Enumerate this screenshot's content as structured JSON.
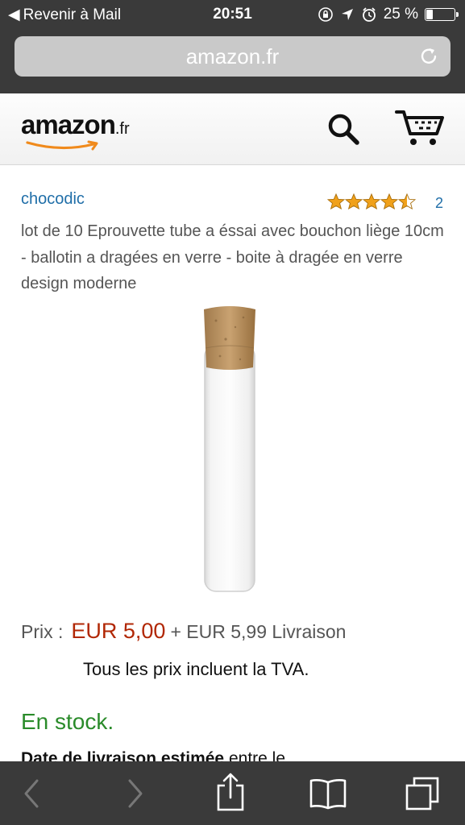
{
  "status_bar": {
    "back_label": "Revenir à Mail",
    "time": "20:51",
    "battery": "25 %",
    "battery_level": 0.25
  },
  "browser": {
    "url": "amazon.fr"
  },
  "header": {
    "logo_word": "amazon",
    "logo_tld": ".fr"
  },
  "product": {
    "brand": "chocodic",
    "rating_stars": 4.5,
    "rating_count": "2",
    "title": "lot de 10 Eprouvette tube a éssai avec bouchon liège 10cm - ballotin a dragées en verre - boite à dragée en verre design moderne",
    "price_label": "Prix :",
    "price": "EUR 5,00",
    "shipping": "+ EUR 5,99 Livraison",
    "tax_note": "Tous les prix incluent la TVA.",
    "stock": "En stock.",
    "delivery_bold": "Date de livraison estimée",
    "delivery_rest": " entre le"
  },
  "colors": {
    "chrome": "#3a3a3a",
    "link": "#1f6ea8",
    "price": "#b12704",
    "stock": "#2a8b2a",
    "star": "#f0a11b"
  }
}
